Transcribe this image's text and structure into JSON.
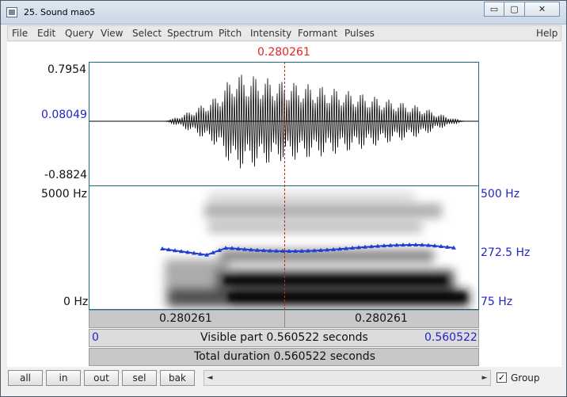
{
  "window": {
    "title": "25. Sound mao5"
  },
  "window_buttons": {
    "minimize": "▭",
    "maximize": "▢",
    "close": "✕"
  },
  "menu": [
    {
      "label": "File"
    },
    {
      "label": "Edit"
    },
    {
      "label": "Query"
    },
    {
      "label": "View"
    },
    {
      "label": "Select"
    },
    {
      "label": "Spectrum"
    },
    {
      "label": "Pitch"
    },
    {
      "label": "Intensity"
    },
    {
      "label": "Formant"
    },
    {
      "label": "Pulses"
    },
    {
      "label": "Help"
    }
  ],
  "cursor": {
    "time": "0.280261"
  },
  "waveform": {
    "max": "0.7954",
    "cursor_value": "0.08049",
    "min": "-0.8824"
  },
  "spectrogram": {
    "freq_top": "5000 Hz",
    "freq_bottom": "0 Hz"
  },
  "pitch": {
    "top": "500 Hz",
    "mid": "272.5 Hz",
    "bottom": "75 Hz",
    "color": "#1f3fd0"
  },
  "tiers": {
    "left_time": "0.280261",
    "right_time": "0.280261",
    "visible_start": "0",
    "visible_label": "Visible part 0.560522 seconds",
    "visible_end": "0.560522",
    "total_label": "Total duration 0.560522 seconds"
  },
  "buttons": {
    "all": "all",
    "in": "in",
    "out": "out",
    "sel": "sel",
    "bak": "bak"
  },
  "scroll": {
    "left": "◄",
    "right": "►"
  },
  "group": {
    "checked": "✓",
    "label": "Group"
  }
}
